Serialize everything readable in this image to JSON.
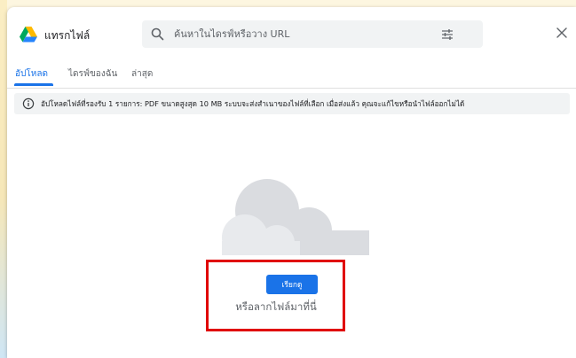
{
  "header": {
    "title": "แทรกไฟล์",
    "search_placeholder": "ค้นหาในไดรฟ์หรือวาง URL"
  },
  "tabs": [
    {
      "label": "อัปโหลด",
      "active": true
    },
    {
      "label": "ไดรฟ์ของฉัน",
      "active": false
    },
    {
      "label": "ล่าสุด",
      "active": false
    }
  ],
  "info": {
    "text": "อัปโหลดไฟล์ที่รองรับ 1 รายการ: PDF ขนาดสูงสุด 10 MB ระบบจะส่งสำเนาของไฟล์ที่เลือก เมื่อส่งแล้ว คุณจะแก้ไขหรือนำไฟล์ออกไม่ได้"
  },
  "upload": {
    "browse_label": "เรียกดู",
    "drag_text": "หรือลากไฟล์มาที่นี่"
  },
  "icons": [
    "google-drive-logo",
    "search-icon",
    "filter-icon",
    "close-icon",
    "info-icon",
    "cloud-illustration"
  ],
  "colors": {
    "accent": "#1a73e8",
    "highlight": "#e00000",
    "banner_bg": "#f1f3f4"
  }
}
